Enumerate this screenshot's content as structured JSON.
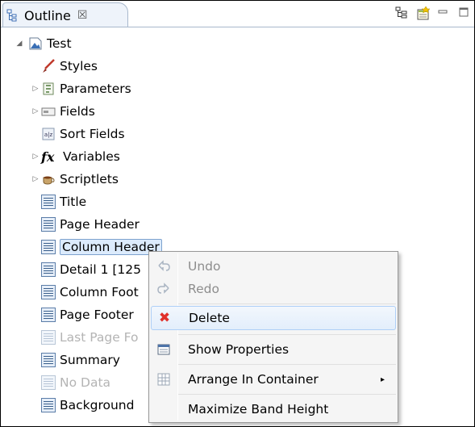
{
  "view": {
    "tab_label": "Outline",
    "tab_close": "☒"
  },
  "tree": {
    "root": "Test",
    "items": [
      {
        "label": "Styles",
        "icon": "brush-icon",
        "expandable": false,
        "disabled": false
      },
      {
        "label": "Parameters",
        "icon": "parameters-icon",
        "expandable": true,
        "disabled": false
      },
      {
        "label": "Fields",
        "icon": "fields-icon",
        "expandable": true,
        "disabled": false
      },
      {
        "label": "Sort Fields",
        "icon": "sort-fields-icon",
        "expandable": false,
        "disabled": false
      },
      {
        "label": "Variables",
        "icon": "variables-icon",
        "expandable": true,
        "disabled": false
      },
      {
        "label": "Scriptlets",
        "icon": "scriptlets-icon",
        "expandable": true,
        "disabled": false
      },
      {
        "label": "Title",
        "icon": "band-icon",
        "expandable": false,
        "disabled": false
      },
      {
        "label": "Page Header",
        "icon": "band-icon",
        "expandable": false,
        "disabled": false
      },
      {
        "label": "Column Header",
        "icon": "band-icon",
        "expandable": false,
        "disabled": false,
        "selected": true
      },
      {
        "label": "Detail 1 [125",
        "icon": "band-icon",
        "expandable": false,
        "disabled": false
      },
      {
        "label": "Column Foot",
        "icon": "band-icon",
        "expandable": false,
        "disabled": false
      },
      {
        "label": "Page Footer",
        "icon": "band-icon",
        "expandable": false,
        "disabled": false
      },
      {
        "label": "Last Page Fo",
        "icon": "band-icon",
        "expandable": false,
        "disabled": true
      },
      {
        "label": "Summary",
        "icon": "band-icon",
        "expandable": false,
        "disabled": false
      },
      {
        "label": "No Data",
        "icon": "band-icon",
        "expandable": false,
        "disabled": true
      },
      {
        "label": "Background",
        "icon": "band-icon",
        "expandable": false,
        "disabled": false
      }
    ],
    "fx_glyph": "fx"
  },
  "context_menu": {
    "undo": "Undo",
    "redo": "Redo",
    "delete": "Delete",
    "show_properties": "Show Properties",
    "arrange_in_container": "Arrange In Container",
    "maximize_band_height": "Maximize Band Height",
    "delete_glyph": "✖",
    "submenu_arrow": "▸"
  },
  "colors": {
    "selection_fill": "#dcebfc",
    "selection_border": "#7da2ce",
    "delete_red": "#e0312b",
    "tab_border": "#a8b8cc"
  }
}
